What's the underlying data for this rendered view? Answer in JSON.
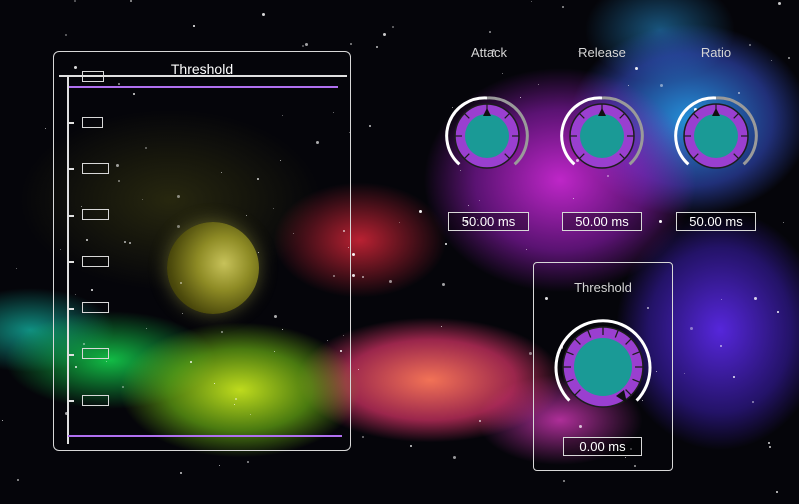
{
  "meter": {
    "title": "Threshold"
  },
  "knobs": {
    "attack": {
      "label": "Attack",
      "value": "50.00 ms"
    },
    "release": {
      "label": "Release",
      "value": "50.00 ms"
    },
    "ratio": {
      "label": "Ratio",
      "value": "50.00 ms"
    },
    "threshold": {
      "label": "Threshold",
      "value": "0.00 ms"
    }
  },
  "colors": {
    "knob_fill": "#1a9a96",
    "knob_ring": "#9a3fd0",
    "meter_line": "#b070f0",
    "outline": "#d8d8d8"
  }
}
